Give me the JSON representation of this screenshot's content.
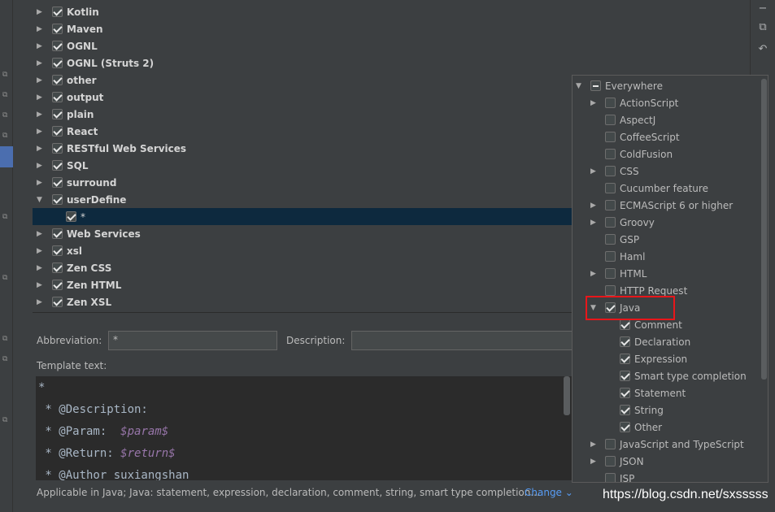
{
  "tree": {
    "groups": [
      {
        "label": "Kotlin",
        "expanded": false,
        "checked": true
      },
      {
        "label": "Maven",
        "expanded": false,
        "checked": true
      },
      {
        "label": "OGNL",
        "expanded": false,
        "checked": true
      },
      {
        "label": "OGNL (Struts 2)",
        "expanded": false,
        "checked": true
      },
      {
        "label": "other",
        "expanded": false,
        "checked": true
      },
      {
        "label": "output",
        "expanded": false,
        "checked": true
      },
      {
        "label": "plain",
        "expanded": false,
        "checked": true
      },
      {
        "label": "React",
        "expanded": false,
        "checked": true
      },
      {
        "label": "RESTful Web Services",
        "expanded": false,
        "checked": true
      },
      {
        "label": "SQL",
        "expanded": false,
        "checked": true
      },
      {
        "label": "surround",
        "expanded": false,
        "checked": true
      },
      {
        "label": "userDefine",
        "expanded": true,
        "checked": true
      },
      {
        "label": "*",
        "child": true,
        "checked": true,
        "selected": true
      },
      {
        "label": "Web Services",
        "expanded": false,
        "checked": true
      },
      {
        "label": "xsl",
        "expanded": false,
        "checked": true
      },
      {
        "label": "Zen CSS",
        "expanded": false,
        "checked": true
      },
      {
        "label": "Zen HTML",
        "expanded": false,
        "checked": true
      },
      {
        "label": "Zen XSL",
        "expanded": false,
        "checked": true
      }
    ]
  },
  "toolbar": {
    "icons": [
      "minus-icon",
      "copy-icon",
      "undo-icon"
    ]
  },
  "form": {
    "abbreviation_label": "Abbreviation:",
    "abbreviation_value": "*",
    "description_label": "Description:",
    "description_value": "",
    "template_label": "Template text:"
  },
  "editor": {
    "lines": [
      {
        "text": "*"
      },
      {
        "text": " * @Description:"
      },
      {
        "text": " * @Param:  ",
        "var": "$param$"
      },
      {
        "text": " * @Return: ",
        "var": "$return$"
      },
      {
        "text": " * @Author suxiangshan"
      }
    ]
  },
  "footer": {
    "applicable": "Applicable in Java; Java: statement, expression, declaration, comment, string, smart type completion...",
    "change_label": "Change",
    "watermark": "https://blog.csdn.net/sxsssss"
  },
  "popup": {
    "items": [
      {
        "label": "Everywhere",
        "level": 0,
        "arrow": "down",
        "state": "partial"
      },
      {
        "label": "ActionScript",
        "level": 1,
        "arrow": "right",
        "state": "unchecked"
      },
      {
        "label": "AspectJ",
        "level": 1,
        "arrow": "",
        "state": "unchecked"
      },
      {
        "label": "CoffeeScript",
        "level": 1,
        "arrow": "",
        "state": "unchecked"
      },
      {
        "label": "ColdFusion",
        "level": 1,
        "arrow": "",
        "state": "unchecked"
      },
      {
        "label": "CSS",
        "level": 1,
        "arrow": "right",
        "state": "unchecked"
      },
      {
        "label": "Cucumber feature",
        "level": 1,
        "arrow": "",
        "state": "unchecked"
      },
      {
        "label": "ECMAScript 6 or higher",
        "level": 1,
        "arrow": "right",
        "state": "unchecked"
      },
      {
        "label": "Groovy",
        "level": 1,
        "arrow": "right",
        "state": "unchecked"
      },
      {
        "label": "GSP",
        "level": 1,
        "arrow": "",
        "state": "unchecked"
      },
      {
        "label": "Haml",
        "level": 1,
        "arrow": "",
        "state": "unchecked"
      },
      {
        "label": "HTML",
        "level": 1,
        "arrow": "right",
        "state": "unchecked"
      },
      {
        "label": "HTTP Request",
        "level": 1,
        "arrow": "",
        "state": "unchecked"
      },
      {
        "label": "Java",
        "level": 1,
        "arrow": "down",
        "state": "checked"
      },
      {
        "label": "Comment",
        "level": 2,
        "arrow": "",
        "state": "checked"
      },
      {
        "label": "Declaration",
        "level": 2,
        "arrow": "",
        "state": "checked"
      },
      {
        "label": "Expression",
        "level": 2,
        "arrow": "",
        "state": "checked"
      },
      {
        "label": "Smart type completion",
        "level": 2,
        "arrow": "",
        "state": "checked"
      },
      {
        "label": "Statement",
        "level": 2,
        "arrow": "",
        "state": "checked"
      },
      {
        "label": "String",
        "level": 2,
        "arrow": "",
        "state": "checked"
      },
      {
        "label": "Other",
        "level": 2,
        "arrow": "",
        "state": "checked"
      },
      {
        "label": "JavaScript and TypeScript",
        "level": 1,
        "arrow": "right",
        "state": "unchecked"
      },
      {
        "label": "JSON",
        "level": 1,
        "arrow": "right",
        "state": "unchecked"
      },
      {
        "label": "JSP",
        "level": 1,
        "arrow": "",
        "state": "unchecked"
      }
    ]
  },
  "colors": {
    "background": "#3c3f41",
    "selection": "#0d293e",
    "link": "#589df6",
    "highlight_box": "#e8161a"
  }
}
